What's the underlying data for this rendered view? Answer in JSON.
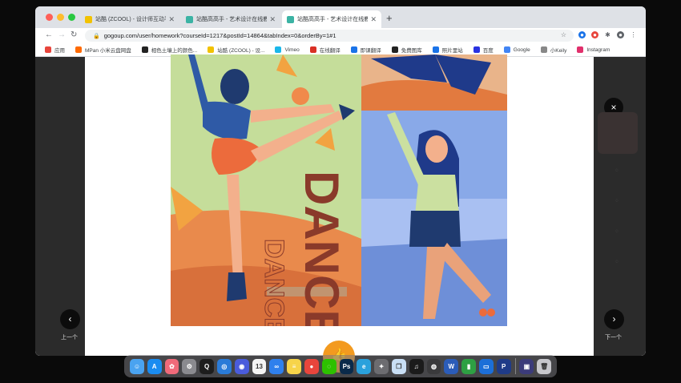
{
  "browser": {
    "tabs": [
      {
        "title": "站酷 (ZCOOL) - 设计师互动平台",
        "color": "#f2c200",
        "active": false
      },
      {
        "title": "站酷高高手 - 艺术设计在线教育",
        "color": "#3bb3a4",
        "active": false
      },
      {
        "title": "站酷高高手 - 艺术设计在线教育",
        "color": "#3bb3a4",
        "active": true
      }
    ],
    "new_tab": "+",
    "url": "gogoup.com/user/homework?courseId=1217&postId=14864&tabIndex=0&orderBy=1#1",
    "bookmarks": [
      {
        "label": "应用",
        "color": "#e8453c"
      },
      {
        "label": "MPan 小米云盘网盘",
        "color": "#ff6a00"
      },
      {
        "label": "相色土壤上的颜色...",
        "color": "#222222"
      },
      {
        "label": "站酷 (ZCOOL) - 设...",
        "color": "#f2c200"
      },
      {
        "label": "Vimeo",
        "color": "#1ab7ea"
      },
      {
        "label": "在线翻译",
        "color": "#d93025"
      },
      {
        "label": "即课翻译",
        "color": "#1a73e8"
      },
      {
        "label": "免费图库",
        "color": "#222222"
      },
      {
        "label": "照片里站",
        "color": "#1a73e8"
      },
      {
        "label": "百度",
        "color": "#2932e1"
      },
      {
        "label": "Google",
        "color": "#4285f4"
      },
      {
        "label": "小Keily",
        "color": "#888888"
      },
      {
        "label": "Instagram",
        "color": "#e1306c"
      }
    ]
  },
  "viewer": {
    "prev_label": "上一个",
    "next_label": "下一个",
    "close_symbol": "×",
    "prev_symbol": "‹",
    "next_symbol": "›",
    "like_symbol": "👍",
    "artwork_text_large": "DANCE",
    "artwork_text_small": "DANCE"
  },
  "dock": {
    "apps": [
      {
        "name": "finder-icon",
        "color": "#4aa3f0",
        "glyph": "☺"
      },
      {
        "name": "app-store-icon",
        "color": "#1a8cf0",
        "glyph": "A"
      },
      {
        "name": "photos-icon",
        "color": "#f06a7a",
        "glyph": "✿"
      },
      {
        "name": "settings-icon",
        "color": "#8a8a8f",
        "glyph": "⚙"
      },
      {
        "name": "qq-icon",
        "color": "#1d1d1d",
        "glyph": "Q"
      },
      {
        "name": "safari-icon",
        "color": "#2a7bd8",
        "glyph": "◎"
      },
      {
        "name": "siri-icon",
        "color": "#4a5cdc",
        "glyph": "◉"
      },
      {
        "name": "calendar-icon",
        "color": "#f4f4f4",
        "glyph": "13"
      },
      {
        "name": "connect-icon",
        "color": "#2f80ed",
        "glyph": "∞"
      },
      {
        "name": "notes-icon",
        "color": "#f7d44a",
        "glyph": "≡"
      },
      {
        "name": "chrome-icon",
        "color": "#e8453c",
        "glyph": "●"
      },
      {
        "name": "wechat-icon",
        "color": "#2dc100",
        "glyph": "◌"
      },
      {
        "name": "photoshop-icon",
        "color": "#0a2a4a",
        "glyph": "Ps"
      },
      {
        "name": "browser-icon",
        "color": "#2aa1dc",
        "glyph": "e"
      },
      {
        "name": "launchpad-icon",
        "color": "#6c6c70",
        "glyph": "✦"
      },
      {
        "name": "preview-icon",
        "color": "#c9dff5",
        "glyph": "❐"
      },
      {
        "name": "music-icon",
        "color": "#1b1b1b",
        "glyph": "♫"
      },
      {
        "name": "camera-icon",
        "color": "#3a3a3c",
        "glyph": "◍"
      },
      {
        "name": "word-icon",
        "color": "#2b5cb8",
        "glyph": "W"
      },
      {
        "name": "numbers-icon",
        "color": "#2ea043",
        "glyph": "▮"
      },
      {
        "name": "keynote-icon",
        "color": "#1c6fd8",
        "glyph": "▭"
      },
      {
        "name": "paypal-icon",
        "color": "#1f3b88",
        "glyph": "P"
      },
      {
        "name": "keynote-doc-icon",
        "color": "#3b3b7a",
        "glyph": "▣"
      },
      {
        "name": "trash-icon",
        "color": "#c7c7cc",
        "glyph": "🗑"
      }
    ]
  }
}
